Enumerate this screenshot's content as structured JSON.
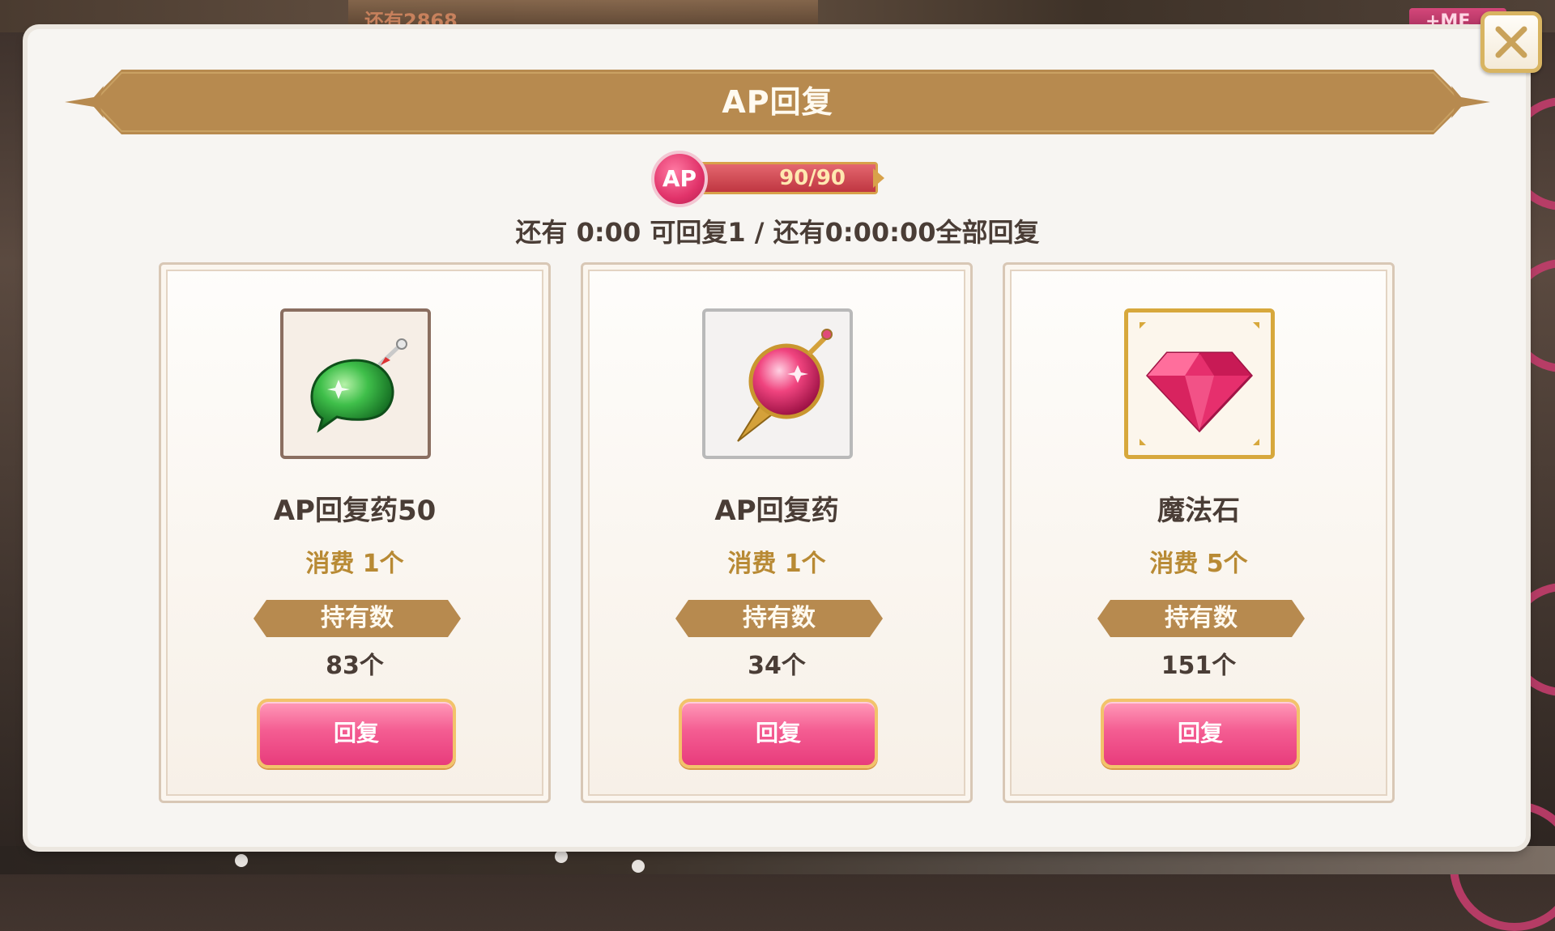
{
  "background": {
    "top_banner_text": "还有2868",
    "top_right_text": "+ME"
  },
  "dialog": {
    "title": "AP回复",
    "close_icon": "close-x-icon",
    "accent_color": "#b78a4f",
    "ap": {
      "badge": "AP",
      "current": 90,
      "max": 90,
      "display": "90/90",
      "fill_fraction": 1.0
    },
    "recovery_info": "还有 0:00 可回复1 / 还有0:00:00全部回复",
    "items": [
      {
        "icon": "green-potion-icon",
        "name": "AP回复药50",
        "cost": "消费 1个",
        "owned_label": "持有数",
        "owned_count": "83个",
        "button": "回复"
      },
      {
        "icon": "pink-potion-icon",
        "name": "AP回复药",
        "cost": "消费 1个",
        "owned_label": "持有数",
        "owned_count": "34个",
        "button": "回复"
      },
      {
        "icon": "magic-stone-gem-icon",
        "name": "魔法石",
        "cost": "消费 5个",
        "owned_label": "持有数",
        "owned_count": "151个",
        "button": "回复"
      }
    ]
  }
}
